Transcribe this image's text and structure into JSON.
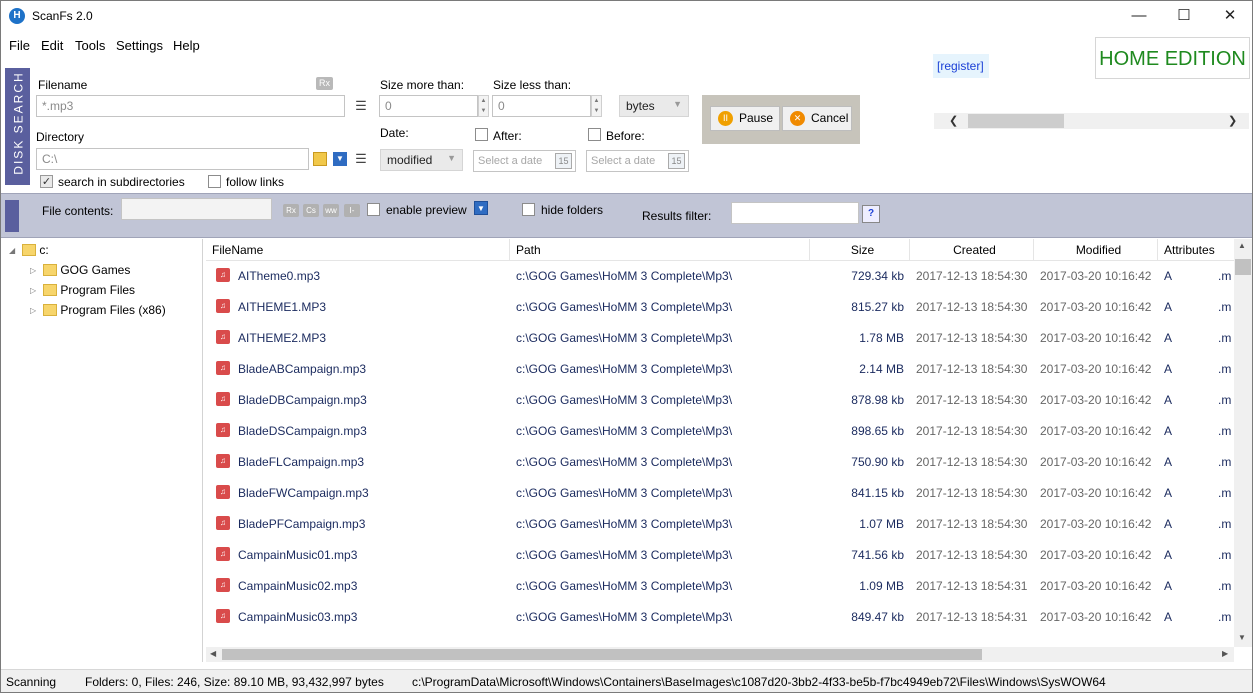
{
  "window": {
    "title": "ScanFs 2.0",
    "icon_letter": "H",
    "minimize": "—",
    "maximize": "☐",
    "close": "✕"
  },
  "menu": [
    "File",
    "Edit",
    "Tools",
    "Settings",
    "Help"
  ],
  "search": {
    "tab_label": "DISK SEARCH",
    "filename_label": "Filename",
    "filename_value": "*.mp3",
    "rx_label": "Rx",
    "directory_label": "Directory",
    "directory_value": "C:\\",
    "search_subdirs_label": "search in subdirectories",
    "search_subdirs_checked": true,
    "follow_links_label": "follow links",
    "follow_links_checked": false,
    "size_more_label": "Size more than:",
    "size_more_value": "0",
    "size_less_label": "Size less than:",
    "size_less_value": "0",
    "size_unit": "bytes",
    "date_label": "Date:",
    "date_type": "modified",
    "after_label": "After:",
    "before_label": "Before:",
    "date_placeholder": "Select a date",
    "calendar_day": "15"
  },
  "actions": {
    "pause": "Pause",
    "cancel": "Cancel"
  },
  "register_link": "[register]",
  "edition": "HOME EDITION",
  "filter": {
    "file_contents_label": "File contents:",
    "badges": [
      "Rx",
      "Cs",
      "ww",
      "I-"
    ],
    "enable_preview_label": "enable preview",
    "hide_folders_label": "hide folders",
    "results_filter_label": "Results filter:",
    "help": "?"
  },
  "tree": {
    "root": "c:",
    "children": [
      "GOG Games",
      "Program Files",
      "Program Files (x86)"
    ]
  },
  "columns": [
    "FileName",
    "Path",
    "Size",
    "Created",
    "Modified",
    "Attributes"
  ],
  "rows": [
    {
      "name": "AITheme0.mp3",
      "path": "c:\\GOG Games\\HoMM 3 Complete\\Mp3\\",
      "size": "729.34 kb",
      "created": "2017-12-13 18:54:30",
      "modified": "2017-03-20 10:16:42",
      "attr": "A",
      "ext": ".m"
    },
    {
      "name": "AITHEME1.MP3",
      "path": "c:\\GOG Games\\HoMM 3 Complete\\Mp3\\",
      "size": "815.27 kb",
      "created": "2017-12-13 18:54:30",
      "modified": "2017-03-20 10:16:42",
      "attr": "A",
      "ext": ".m"
    },
    {
      "name": "AITHEME2.MP3",
      "path": "c:\\GOG Games\\HoMM 3 Complete\\Mp3\\",
      "size": "1.78 MB",
      "created": "2017-12-13 18:54:30",
      "modified": "2017-03-20 10:16:42",
      "attr": "A",
      "ext": ".m"
    },
    {
      "name": "BladeABCampaign.mp3",
      "path": "c:\\GOG Games\\HoMM 3 Complete\\Mp3\\",
      "size": "2.14 MB",
      "created": "2017-12-13 18:54:30",
      "modified": "2017-03-20 10:16:42",
      "attr": "A",
      "ext": ".m"
    },
    {
      "name": "BladeDBCampaign.mp3",
      "path": "c:\\GOG Games\\HoMM 3 Complete\\Mp3\\",
      "size": "878.98 kb",
      "created": "2017-12-13 18:54:30",
      "modified": "2017-03-20 10:16:42",
      "attr": "A",
      "ext": ".m"
    },
    {
      "name": "BladeDSCampaign.mp3",
      "path": "c:\\GOG Games\\HoMM 3 Complete\\Mp3\\",
      "size": "898.65 kb",
      "created": "2017-12-13 18:54:30",
      "modified": "2017-03-20 10:16:42",
      "attr": "A",
      "ext": ".m"
    },
    {
      "name": "BladeFLCampaign.mp3",
      "path": "c:\\GOG Games\\HoMM 3 Complete\\Mp3\\",
      "size": "750.90 kb",
      "created": "2017-12-13 18:54:30",
      "modified": "2017-03-20 10:16:42",
      "attr": "A",
      "ext": ".m"
    },
    {
      "name": "BladeFWCampaign.mp3",
      "path": "c:\\GOG Games\\HoMM 3 Complete\\Mp3\\",
      "size": "841.15 kb",
      "created": "2017-12-13 18:54:30",
      "modified": "2017-03-20 10:16:42",
      "attr": "A",
      "ext": ".m"
    },
    {
      "name": "BladePFCampaign.mp3",
      "path": "c:\\GOG Games\\HoMM 3 Complete\\Mp3\\",
      "size": "1.07 MB",
      "created": "2017-12-13 18:54:30",
      "modified": "2017-03-20 10:16:42",
      "attr": "A",
      "ext": ".m"
    },
    {
      "name": "CampainMusic01.mp3",
      "path": "c:\\GOG Games\\HoMM 3 Complete\\Mp3\\",
      "size": "741.56 kb",
      "created": "2017-12-13 18:54:30",
      "modified": "2017-03-20 10:16:42",
      "attr": "A",
      "ext": ".m"
    },
    {
      "name": "CampainMusic02.mp3",
      "path": "c:\\GOG Games\\HoMM 3 Complete\\Mp3\\",
      "size": "1.09 MB",
      "created": "2017-12-13 18:54:31",
      "modified": "2017-03-20 10:16:42",
      "attr": "A",
      "ext": ".m"
    },
    {
      "name": "CampainMusic03.mp3",
      "path": "c:\\GOG Games\\HoMM 3 Complete\\Mp3\\",
      "size": "849.47 kb",
      "created": "2017-12-13 18:54:31",
      "modified": "2017-03-20 10:16:42",
      "attr": "A",
      "ext": ".m"
    }
  ],
  "status": {
    "state": "Scanning",
    "summary": "Folders: 0, Files: 246, Size: 89.10 MB, 93,432,997 bytes",
    "current_path": "c:\\ProgramData\\Microsoft\\Windows\\Containers\\BaseImages\\c1087d20-3bb2-4f33-be5b-f7bc4949eb72\\Files\\Windows\\SysWOW64"
  }
}
